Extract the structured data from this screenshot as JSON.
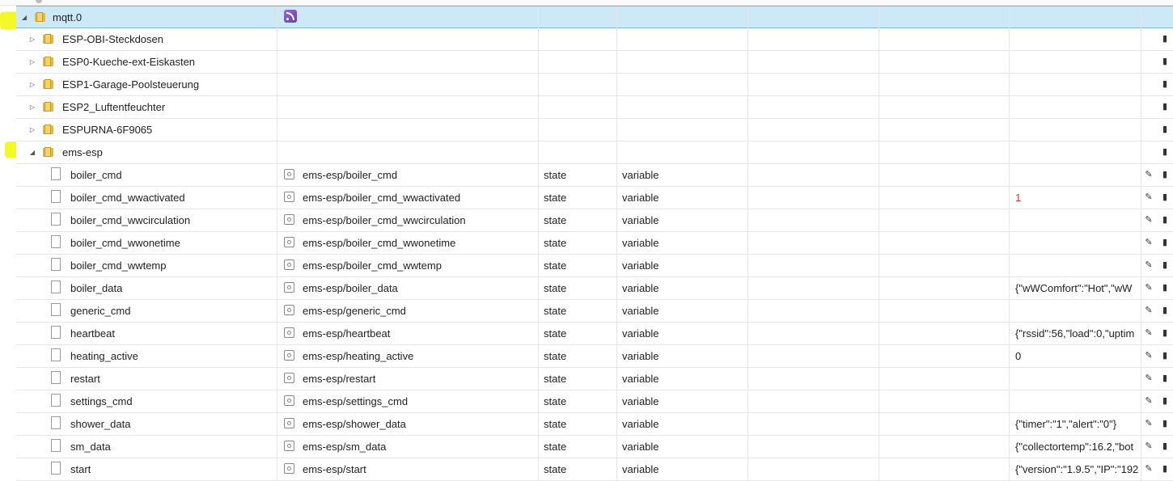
{
  "tree": {
    "root": {
      "name": "mqtt.0"
    },
    "folders": [
      {
        "name": "ESP-OBI-Steckdosen"
      },
      {
        "name": "ESP0-Kueche-ext-Eiskasten"
      },
      {
        "name": "ESP1-Garage-Poolsteuerung"
      },
      {
        "name": "ESP2_Luftentfeuchter"
      },
      {
        "name": "ESPURNA-6F9065"
      },
      {
        "name": "ems-esp"
      }
    ],
    "states": [
      {
        "name": "boiler_cmd",
        "id": "ems-esp/boiler_cmd",
        "type": "state",
        "role": "variable",
        "value": ""
      },
      {
        "name": "boiler_cmd_wwactivated",
        "id": "ems-esp/boiler_cmd_wwactivated",
        "type": "state",
        "role": "variable",
        "value": "1"
      },
      {
        "name": "boiler_cmd_wwcirculation",
        "id": "ems-esp/boiler_cmd_wwcirculation",
        "type": "state",
        "role": "variable",
        "value": ""
      },
      {
        "name": "boiler_cmd_wwonetime",
        "id": "ems-esp/boiler_cmd_wwonetime",
        "type": "state",
        "role": "variable",
        "value": ""
      },
      {
        "name": "boiler_cmd_wwtemp",
        "id": "ems-esp/boiler_cmd_wwtemp",
        "type": "state",
        "role": "variable",
        "value": ""
      },
      {
        "name": "boiler_data",
        "id": "ems-esp/boiler_data",
        "type": "state",
        "role": "variable",
        "value": "{\"wWComfort\":\"Hot\",\"wW"
      },
      {
        "name": "generic_cmd",
        "id": "ems-esp/generic_cmd",
        "type": "state",
        "role": "variable",
        "value": ""
      },
      {
        "name": "heartbeat",
        "id": "ems-esp/heartbeat",
        "type": "state",
        "role": "variable",
        "value": "{\"rssid\":56,\"load\":0,\"uptim"
      },
      {
        "name": "heating_active",
        "id": "ems-esp/heating_active",
        "type": "state",
        "role": "variable",
        "value": "0"
      },
      {
        "name": "restart",
        "id": "ems-esp/restart",
        "type": "state",
        "role": "variable",
        "value": ""
      },
      {
        "name": "settings_cmd",
        "id": "ems-esp/settings_cmd",
        "type": "state",
        "role": "variable",
        "value": ""
      },
      {
        "name": "shower_data",
        "id": "ems-esp/shower_data",
        "type": "state",
        "role": "variable",
        "value": "{\"timer\":\"1\",\"alert\":\"0\"}"
      },
      {
        "name": "sm_data",
        "id": "ems-esp/sm_data",
        "type": "state",
        "role": "variable",
        "value": "{\"collectortemp\":16.2,\"bot"
      },
      {
        "name": "start",
        "id": "ems-esp/start",
        "type": "state",
        "role": "variable",
        "value": "{\"version\":\"1.9.5\",\"IP\":\"192"
      }
    ]
  },
  "icons": {
    "expanded": "triangle-down-icon",
    "collapsed": "triangle-right-icon",
    "folder": "folder-icon",
    "file": "file-icon",
    "state": "state-icon",
    "edit": "pencil-icon",
    "delete": "trash-icon",
    "adapter": "mqtt-adapter-icon"
  },
  "colors": {
    "selected_row": "#cde8f7",
    "highlight": "#f2f700",
    "value_red": "#c0392b"
  }
}
